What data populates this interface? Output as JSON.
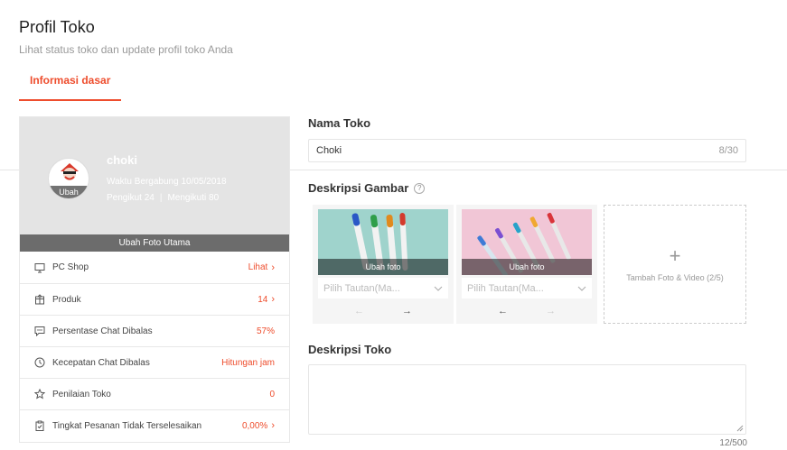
{
  "header": {
    "title": "Profil Toko",
    "subtitle": "Lihat status toko dan update profil toko Anda"
  },
  "tabs": [
    {
      "label": "Informasi dasar",
      "active": true
    }
  ],
  "shop": {
    "name": "choki",
    "joined": "Waktu Bergabung 10/05/2018",
    "followers": "Pengikut 24",
    "following": "Mengikuti 80",
    "avatar_edit": "Ubah",
    "change_photo": "Ubah Foto Utama"
  },
  "metrics": [
    {
      "icon": "monitor-icon",
      "label": "PC Shop",
      "value": "Lihat",
      "chevron": true
    },
    {
      "icon": "box-icon",
      "label": "Produk",
      "value": "14",
      "chevron": true
    },
    {
      "icon": "chat-icon",
      "label": "Persentase Chat Dibalas",
      "value": "57%",
      "chevron": false
    },
    {
      "icon": "clock-icon",
      "label": "Kecepatan Chat Dibalas",
      "value": "Hitungan jam",
      "chevron": false
    },
    {
      "icon": "star-icon",
      "label": "Penilaian Toko",
      "value": "0",
      "chevron": false
    },
    {
      "icon": "clipboard-icon",
      "label": "Tingkat Pesanan Tidak Terselesaikan",
      "value": "0,00%",
      "chevron": true
    }
  ],
  "form": {
    "name_label": "Nama Toko",
    "name_value": "Choki",
    "name_count": "8/30",
    "image_desc_label": "Deskripsi Gambar",
    "help_glyph": "?",
    "images": [
      {
        "caption": "Ubah foto",
        "link_placeholder": "Pilih Tautan(Ma..."
      },
      {
        "caption": "Ubah foto",
        "link_placeholder": "Pilih Tautan(Ma..."
      }
    ],
    "add_media_plus": "+",
    "add_media_label": "Tambah Foto & Video (2/5)",
    "desc_label": "Deskripsi Toko",
    "desc_value": "",
    "desc_count": "12/500"
  },
  "colors": {
    "accent": "#ee4d2d",
    "card_bg": "#e4e4e4",
    "bar_bg": "#6c6c6c"
  }
}
